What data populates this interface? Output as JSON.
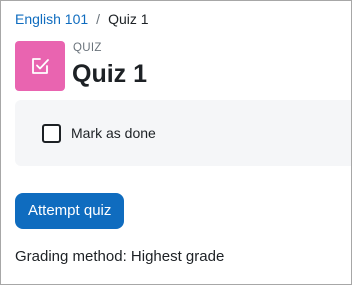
{
  "breadcrumb": {
    "course": "English 101",
    "separator": "/",
    "current": "Quiz 1"
  },
  "header": {
    "module_type": "QUIZ",
    "title": "Quiz 1",
    "icon": "quiz-icon",
    "icon_color": "#e964b0"
  },
  "completion": {
    "checkbox_checked": false,
    "label": "Mark as done"
  },
  "actions": {
    "attempt_label": "Attempt quiz",
    "button_color": "#0f6cbf"
  },
  "info": {
    "grading_method": "Grading method: Highest grade"
  }
}
